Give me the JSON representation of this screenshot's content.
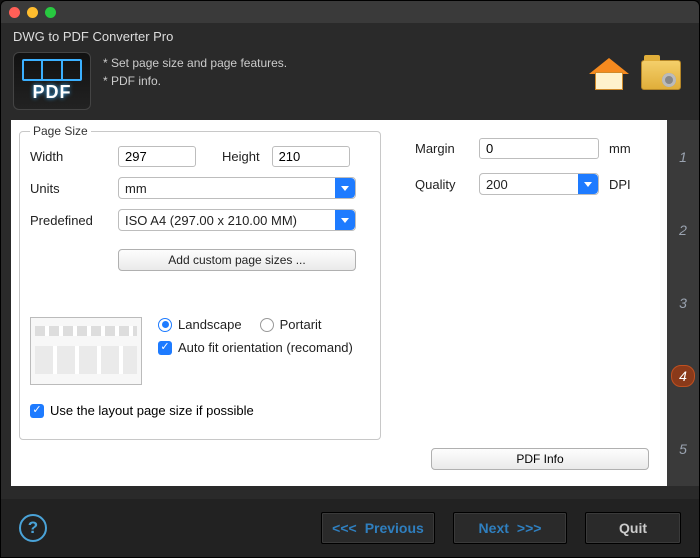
{
  "title": "DWG to PDF Converter Pro",
  "hints": {
    "line1": "* Set page size and page features.",
    "line2": "* PDF info."
  },
  "steps": [
    "1",
    "2",
    "3",
    "4",
    "5"
  ],
  "active_step_index": 3,
  "page_size": {
    "legend": "Page Size",
    "width_label": "Width",
    "width_value": "297",
    "height_label": "Height",
    "height_value": "210",
    "units_label": "Units",
    "units_value": "mm",
    "predefined_label": "Predefined",
    "predefined_value": "ISO A4 (297.00 x 210.00 MM)",
    "add_custom_label": "Add custom page sizes ...",
    "landscape_label": "Landscape",
    "portrait_label": "Portarit",
    "orientation_selected": "landscape",
    "autofit_label": "Auto fit orientation (recomand)",
    "autofit_checked": true,
    "use_layout_label": "Use the layout page size if possible",
    "use_layout_checked": true
  },
  "output": {
    "margin_label": "Margin",
    "margin_value": "0",
    "margin_unit": "mm",
    "quality_label": "Quality",
    "quality_value": "200",
    "quality_unit": "DPI",
    "pdfinfo_label": "PDF Info"
  },
  "footer": {
    "previous": "Previous",
    "next": "Next",
    "quit": "Quit",
    "prev_arrows": "<<<",
    "next_arrows": ">>>"
  }
}
